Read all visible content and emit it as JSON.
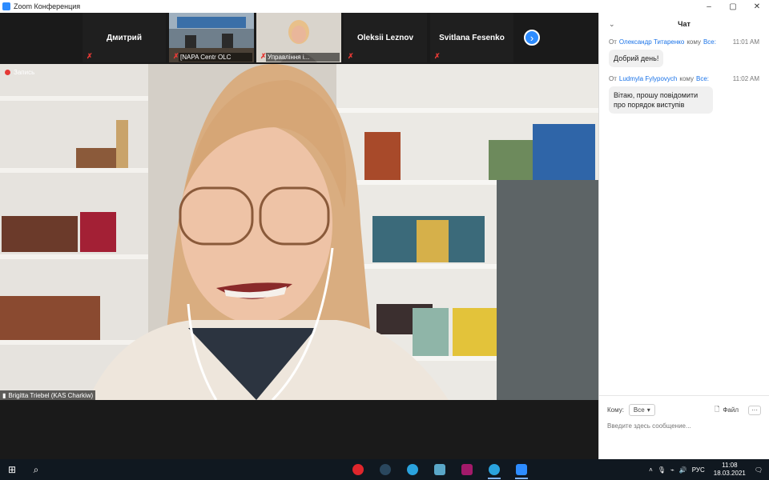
{
  "window": {
    "title": "Zoom Конференция",
    "minimize": "–",
    "maximize": "▢",
    "close": "✕"
  },
  "participants": [
    {
      "name": "Дмитрий",
      "muted": true,
      "video": false
    },
    {
      "name": "[NAPA Centr OLC",
      "muted": true,
      "video": true
    },
    {
      "name": "Управління і...",
      "muted": true,
      "video": true
    },
    {
      "name": "Oleksii Leznov",
      "muted": true,
      "video": false
    },
    {
      "name": "Svitlana Fesenko",
      "muted": true,
      "video": false
    }
  ],
  "strip": {
    "next_icon": "chevron-right-icon"
  },
  "main_video": {
    "recording_label": "Запись",
    "speaker": "Brigitta Triebel (KAS Charkiw)"
  },
  "chat": {
    "title": "Чат",
    "messages": [
      {
        "from_label": "От",
        "sender": "Олександр Титаренко",
        "to_label": "кому",
        "recipient": "Все:",
        "time": "11:01 AM",
        "text": "Добрий день!"
      },
      {
        "from_label": "От",
        "sender": "Ludmyla Fylypovych",
        "to_label": "кому",
        "recipient": "Все:",
        "time": "11:02 AM",
        "text": "Вітаю, прошу повідомити про порядок виступів"
      }
    ],
    "to_label": "Кому:",
    "recipient_value": "Все",
    "file_label": "Файл",
    "more_label": "···",
    "input_placeholder": "Введите здесь сообщение..."
  },
  "taskbar": {
    "apps": [
      {
        "name": "opera",
        "color": "#e0262c"
      },
      {
        "name": "steam",
        "color": "#2a475e"
      },
      {
        "name": "telegram",
        "color": "#2aa3de"
      },
      {
        "name": "notes",
        "color": "#5aa7c8"
      },
      {
        "name": "media",
        "color": "#a31a6a"
      },
      {
        "name": "telegram-2",
        "color": "#2aa3de"
      },
      {
        "name": "zoom",
        "color": "#2d8cff"
      }
    ],
    "language": "РУС",
    "time": "11:08",
    "date": "18.03.2021"
  }
}
